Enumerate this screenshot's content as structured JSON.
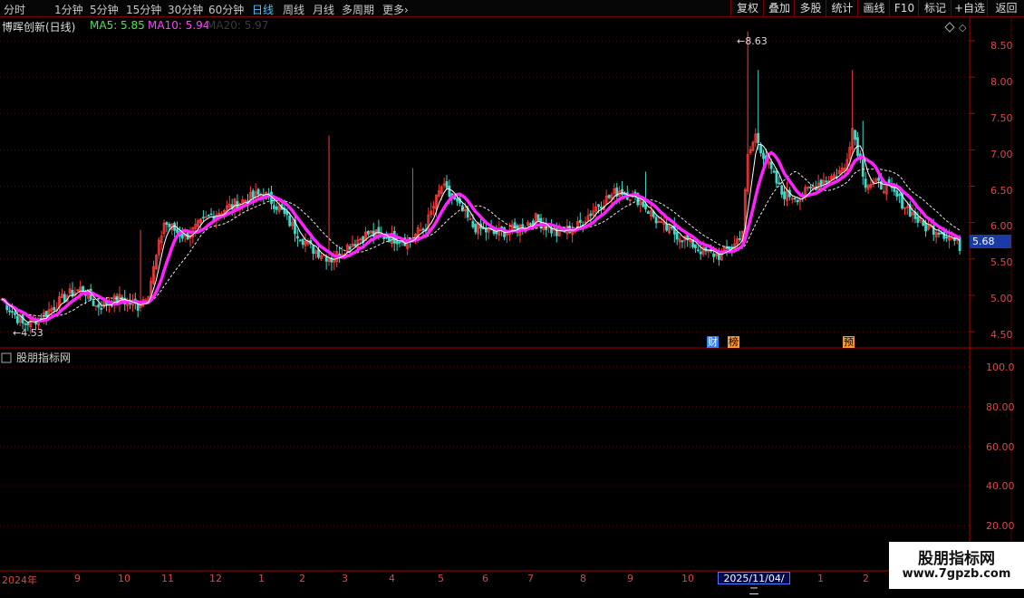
{
  "toolbar": {
    "periods": [
      "分时",
      "1分钟",
      "5分钟",
      "15分钟",
      "30分钟",
      "60分钟",
      "日线",
      "周线",
      "月线",
      "多周期",
      "更多"
    ],
    "active_period": "日线",
    "more_arrow": "›",
    "right_buttons": [
      "复权",
      "叠加",
      "多股",
      "统计",
      "画线",
      "F10",
      "标记",
      "+自选",
      "返回"
    ]
  },
  "header": {
    "stock_title": "博晖创新(日线)",
    "ma5": "MA5: 5.85",
    "ma10": "MA10: 5.94",
    "ma20": "MA20: 5.97"
  },
  "colors": {
    "up": "#ff3a3a",
    "down": "#3fd9c8",
    "ma5": "#ffffff",
    "ma10": "#ff22ff",
    "ma20": "#e8e8e8",
    "axis": "#b00000",
    "ma5_label": "#4fe34f",
    "ma10_label": "#ff44ff",
    "ma20_label": "#3a3a3a"
  },
  "price_axis": [
    "8.50",
    "8.00",
    "7.50",
    "7.00",
    "6.50",
    "6.00",
    "5.50",
    "5.00",
    "4.50"
  ],
  "current_price": "5.68",
  "annotations": {
    "high": "8.63",
    "low": "4.53"
  },
  "event_badges": [
    {
      "text": "财",
      "bg": "#2c7fff"
    },
    {
      "text": "榜",
      "bg": "#ff9a2a"
    },
    {
      "text": "预",
      "bg": "#ff9a2a"
    }
  ],
  "sub_panel": {
    "title": "股朋指标网",
    "axis": [
      "100.0",
      "80.00",
      "60.00",
      "40.00",
      "20.00"
    ]
  },
  "months": [
    "2024年",
    "9",
    "10",
    "11",
    "12",
    "1",
    "2",
    "3",
    "4",
    "5",
    "6",
    "7",
    "8",
    "9",
    "10",
    "1",
    "2"
  ],
  "crosshair_date": "2025/11/04/二",
  "watermark": {
    "title": "股朋指标网",
    "url": "www.7gpzb.com"
  },
  "chart_data": {
    "type": "candlestick",
    "ylim": [
      4.3,
      8.8
    ],
    "high": 8.63,
    "low": 4.53,
    "last": 5.68,
    "ma": {
      "MA5": 5.85,
      "MA10": 5.94,
      "MA20": 5.97
    },
    "close_path": [
      [
        0,
        4.95
      ],
      [
        8,
        4.6
      ],
      [
        15,
        4.7
      ],
      [
        25,
        5.0
      ],
      [
        31,
        5.1
      ],
      [
        36,
        4.85
      ],
      [
        45,
        4.95
      ],
      [
        52,
        4.85
      ],
      [
        56,
        5.05
      ],
      [
        62,
        6.0
      ],
      [
        70,
        5.8
      ],
      [
        80,
        6.1
      ],
      [
        92,
        6.3
      ],
      [
        100,
        6.4
      ],
      [
        106,
        6.2
      ],
      [
        112,
        5.9
      ],
      [
        118,
        5.65
      ],
      [
        126,
        5.5
      ],
      [
        133,
        5.7
      ],
      [
        140,
        5.85
      ],
      [
        148,
        5.8
      ],
      [
        155,
        5.75
      ],
      [
        162,
        5.95
      ],
      [
        168,
        6.5
      ],
      [
        174,
        6.25
      ],
      [
        180,
        5.95
      ],
      [
        188,
        5.85
      ],
      [
        196,
        5.9
      ],
      [
        204,
        6.05
      ],
      [
        212,
        5.85
      ],
      [
        220,
        5.95
      ],
      [
        228,
        6.25
      ],
      [
        236,
        6.45
      ],
      [
        244,
        6.3
      ],
      [
        252,
        5.95
      ],
      [
        260,
        5.8
      ],
      [
        268,
        5.6
      ],
      [
        274,
        5.55
      ],
      [
        280,
        5.7
      ],
      [
        283,
        5.9
      ],
      [
        285,
        6.9
      ],
      [
        288,
        7.2
      ],
      [
        292,
        6.85
      ],
      [
        298,
        6.4
      ],
      [
        305,
        6.35
      ],
      [
        312,
        6.55
      ],
      [
        318,
        6.65
      ],
      [
        322,
        6.75
      ],
      [
        325,
        7.3
      ],
      [
        330,
        6.55
      ],
      [
        338,
        6.5
      ],
      [
        346,
        6.2
      ],
      [
        352,
        5.95
      ],
      [
        358,
        5.9
      ],
      [
        363,
        5.78
      ],
      [
        366,
        5.68
      ]
    ],
    "spikes": [
      [
        53,
        5.9
      ],
      [
        125,
        7.2
      ],
      [
        157,
        6.75
      ],
      [
        246,
        6.7
      ],
      [
        285,
        8.63
      ],
      [
        289,
        8.1
      ],
      [
        325,
        8.1
      ],
      [
        329,
        7.4
      ]
    ],
    "sub_indicator": {
      "ylim": [
        0,
        110
      ],
      "values": []
    }
  }
}
